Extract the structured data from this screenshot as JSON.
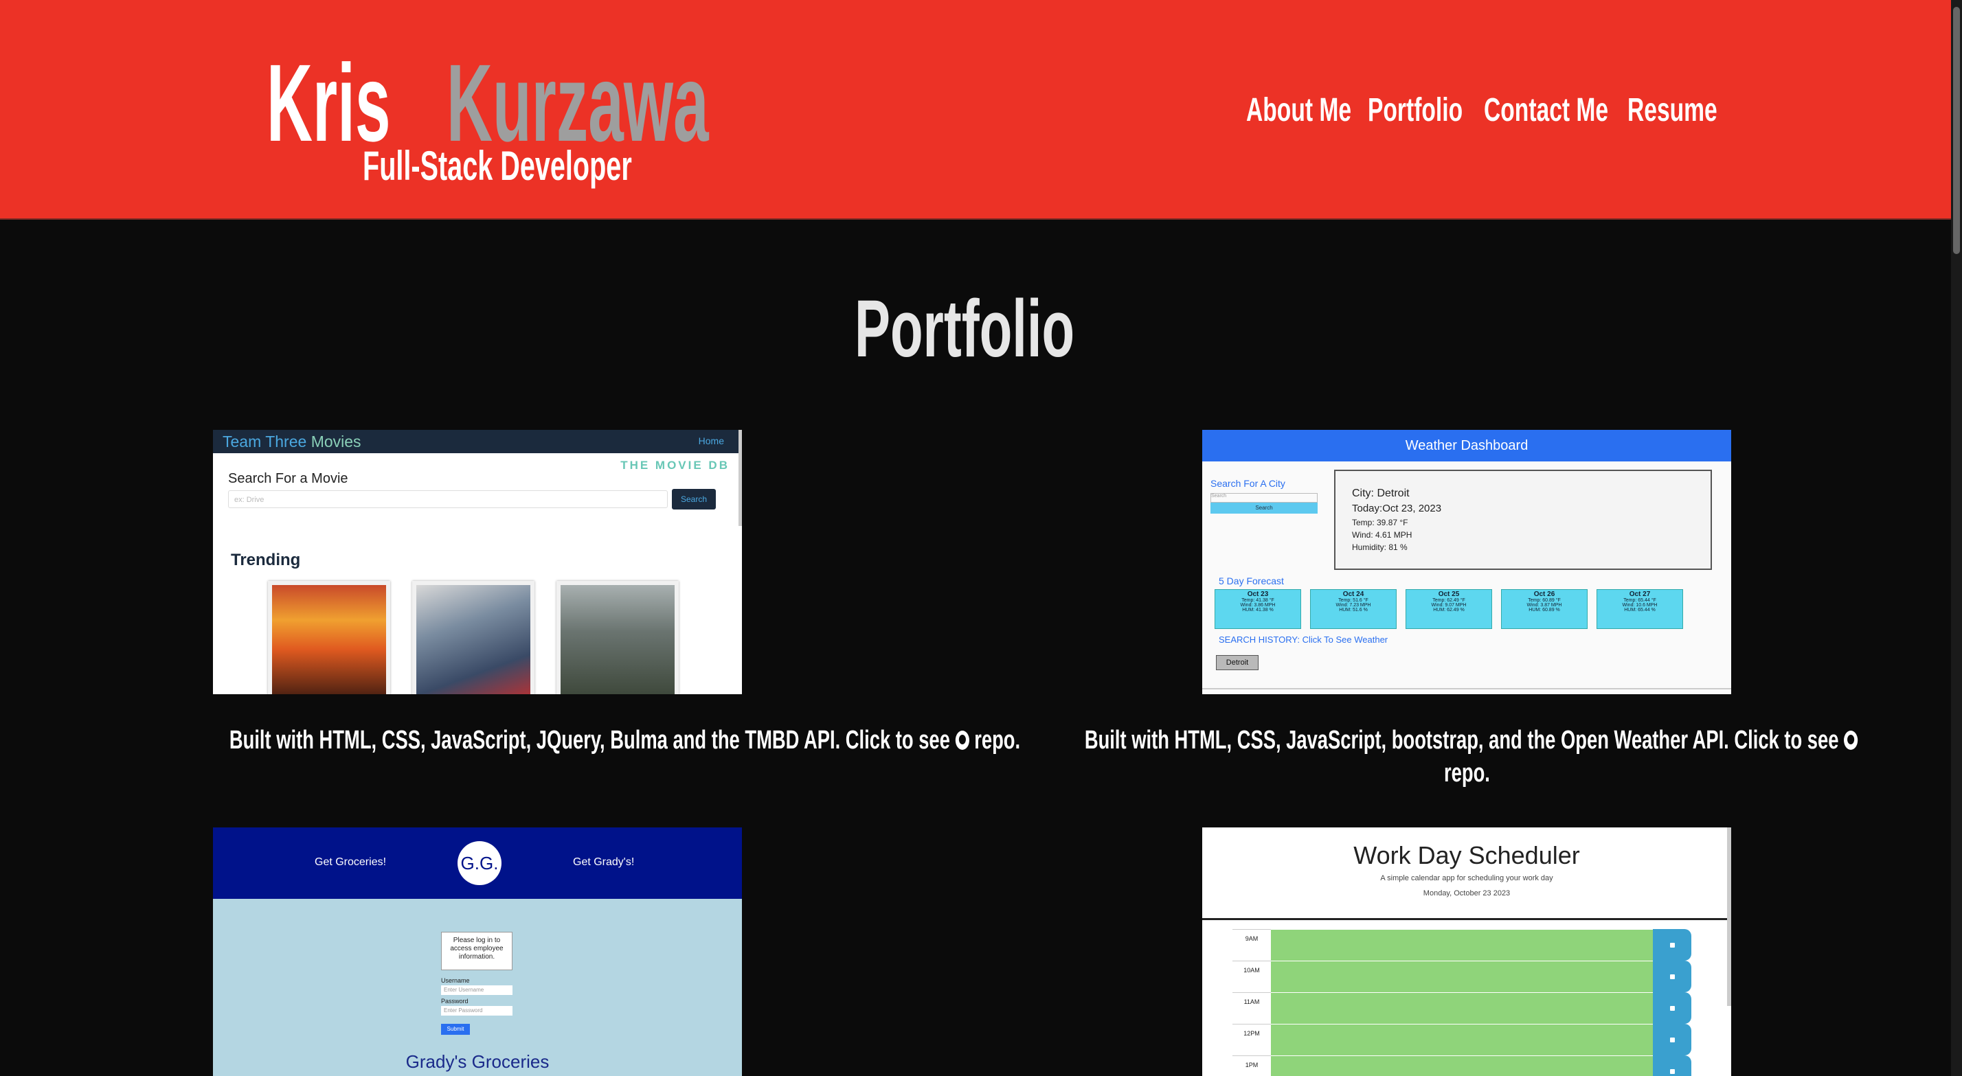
{
  "header": {
    "name_first": "Kris",
    "name_last": "Kurzawa",
    "subtitle": "Full-Stack Developer",
    "nav": [
      "About Me",
      "Portfolio",
      "Contact Me",
      "Resume"
    ]
  },
  "colors": {
    "header_bg": "#ec3226",
    "page_bg": "#0b0b0b",
    "name_last": "#9e9e9e"
  },
  "portfolio": {
    "title": "Portfolio",
    "projects": [
      {
        "caption_before": "Built with HTML, CSS, JavaScript, JQuery, Bulma and the TMBD API. Click to see",
        "caption_after": "repo.",
        "icon": "github-icon",
        "preview": {
          "brand_a": "Team Three",
          "brand_b": "Movies",
          "home": "Home",
          "tmdb_logo": "THE MOVIE DB",
          "search_label": "Search For a Movie",
          "search_placeholder": "ex: Drive",
          "search_button": "Search",
          "trending": "Trending"
        }
      },
      {
        "caption_before": "Built with HTML, CSS, JavaScript, bootstrap, and the Open Weather API. Click to see",
        "caption_after": "repo.",
        "icon": "github-icon",
        "preview": {
          "header": "Weather Dashboard",
          "search_label": "Search For A City",
          "search_placeholder": "Search",
          "search_button": "Search",
          "city": "City: Detroit",
          "today": "Today:Oct 23, 2023",
          "temp": "Temp: 39.87 °F",
          "wind": "Wind: 4.61 MPH",
          "humidity": "Humidity: 81 %",
          "forecast_label": "5 Day Forecast",
          "forecast": [
            {
              "date": "Oct 23",
              "temp": "Temp: 41.38 °F",
              "wind": "Wind: 3.86 MPH",
              "hum": "HUM: 41.38 %"
            },
            {
              "date": "Oct 24",
              "temp": "Temp: 51.6 °F",
              "wind": "Wind: 7.23 MPH",
              "hum": "HUM: 51.6 %"
            },
            {
              "date": "Oct 25",
              "temp": "Temp: 62.49 °F",
              "wind": "Wind: 9.07 MPH",
              "hum": "HUM: 62.49 %"
            },
            {
              "date": "Oct 26",
              "temp": "Temp: 60.89 °F",
              "wind": "Wind: 3.87 MPH",
              "hum": "HUM: 60.89 %"
            },
            {
              "date": "Oct 27",
              "temp": "Temp: 65.44 °F",
              "wind": "Wind: 10.6 MPH",
              "hum": "HUM: 65.44 %"
            }
          ],
          "history_label": "SEARCH HISTORY: Click To See Weather",
          "history_button": "Detroit"
        }
      },
      {
        "preview": {
          "nav_left": "Get Groceries!",
          "logo": "G.G.",
          "nav_right": "Get Grady's!",
          "login_prompt": "Please log in to access employee information.",
          "username_label": "Username",
          "username_placeholder": "Enter Username",
          "password_label": "Password",
          "password_placeholder": "Enter Password",
          "submit": "Submit",
          "title": "Grady's Groceries"
        }
      },
      {
        "preview": {
          "title": "Work Day Scheduler",
          "subtitle": "A simple calendar app for scheduling your work day",
          "date": "Monday, October 23 2023",
          "hours": [
            "9AM",
            "10AM",
            "11AM",
            "12PM",
            "1PM"
          ]
        }
      }
    ]
  }
}
